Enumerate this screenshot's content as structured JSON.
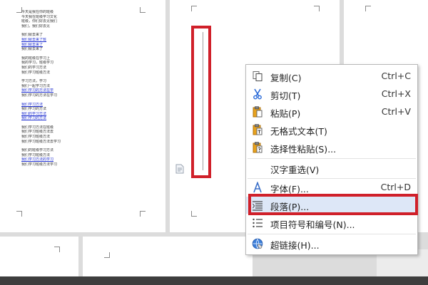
{
  "document": {
    "left_page_lines": [
      {
        "text": "今天是我在你的班级",
        "style": "text"
      },
      {
        "text": "今天我在班级学习文化",
        "style": "text"
      },
      {
        "text": "班级，你们好去见我们",
        "style": "text"
      },
      {
        "text": "我们，我们好去见",
        "style": "text"
      },
      {
        "text": "",
        "style": "gap"
      },
      {
        "text": "我们就去来了",
        "style": "text"
      },
      {
        "text": "我们就去来了班",
        "style": "link"
      },
      {
        "text": "我们就去来了",
        "style": "link"
      },
      {
        "text": "我们就去来了",
        "style": "text"
      },
      {
        "text": "",
        "style": "gap"
      },
      {
        "text": "我的班级在学习上",
        "style": "text"
      },
      {
        "text": "我的学习，班级学习",
        "style": "text"
      },
      {
        "text": "我们的学习方法",
        "style": "text"
      },
      {
        "text": "我们学习班级方法",
        "style": "text"
      },
      {
        "text": "",
        "style": "gap"
      },
      {
        "text": "学习方法，学习",
        "style": "text"
      },
      {
        "text": "我们一起学习方法",
        "style": "text"
      },
      {
        "text": "我们学习的方法在学",
        "style": "link"
      },
      {
        "text": "我们学习的方法在学习",
        "style": "text"
      },
      {
        "text": "",
        "style": "gap"
      },
      {
        "text": "我们学习方法",
        "style": "link"
      },
      {
        "text": "我们学习的方法",
        "style": "text"
      },
      {
        "text": "我们的学习方法",
        "style": "link"
      },
      {
        "text": "我们学习的方法",
        "style": "link"
      },
      {
        "text": "",
        "style": "gap"
      },
      {
        "text": "我们学习方法在班级",
        "style": "text"
      },
      {
        "text": "我们学习班级方法去",
        "style": "text"
      },
      {
        "text": "我们学习班级方法",
        "style": "text"
      },
      {
        "text": "我们学习班级方法去学习",
        "style": "text"
      },
      {
        "text": "",
        "style": "gap"
      },
      {
        "text": "我们的班级学习方法",
        "style": "text"
      },
      {
        "text": "我们学习班级方法",
        "style": "text"
      },
      {
        "text": "我们学习方法的学习",
        "style": "link"
      },
      {
        "text": "我们学习班级方法学习",
        "style": "text"
      }
    ]
  },
  "context_menu": {
    "items": [
      {
        "name": "menu-item-copy",
        "icon": "copy-icon",
        "label": "复制(C)",
        "shortcut": "Ctrl+C"
      },
      {
        "name": "menu-item-cut",
        "icon": "scissors-icon",
        "label": "剪切(T)",
        "shortcut": "Ctrl+X"
      },
      {
        "name": "menu-item-paste",
        "icon": "paste-icon",
        "label": "粘贴(P)",
        "shortcut": "Ctrl+V"
      },
      {
        "name": "menu-item-paste-plain",
        "icon": "paste-plain-icon",
        "label": "无格式文本(T)",
        "shortcut": ""
      },
      {
        "name": "menu-item-paste-special",
        "icon": "paste-special-icon",
        "label": "选择性粘贴(S)...",
        "shortcut": ""
      },
      {
        "name": "menu-item-reconversion",
        "icon": "",
        "label": "汉字重选(V)",
        "shortcut": ""
      },
      {
        "name": "menu-item-font",
        "icon": "font-icon",
        "label": "字体(F)...",
        "shortcut": "Ctrl+D"
      },
      {
        "name": "menu-item-paragraph",
        "icon": "paragraph-icon",
        "label": "段落(P)...",
        "shortcut": ""
      },
      {
        "name": "menu-item-bullets-numbering",
        "icon": "bullet-list-icon",
        "label": "项目符号和编号(N)...",
        "shortcut": ""
      },
      {
        "name": "menu-item-hyperlink",
        "icon": "hyperlink-icon",
        "label": "超链接(H)...",
        "shortcut": ""
      }
    ],
    "hovered_item": "menu-item-paragraph"
  },
  "colors": {
    "highlight_border": "#d0202a",
    "hover_background": "#dde7f7",
    "page_background": "#ffffff",
    "workspace_background": "#dcdcdc"
  }
}
